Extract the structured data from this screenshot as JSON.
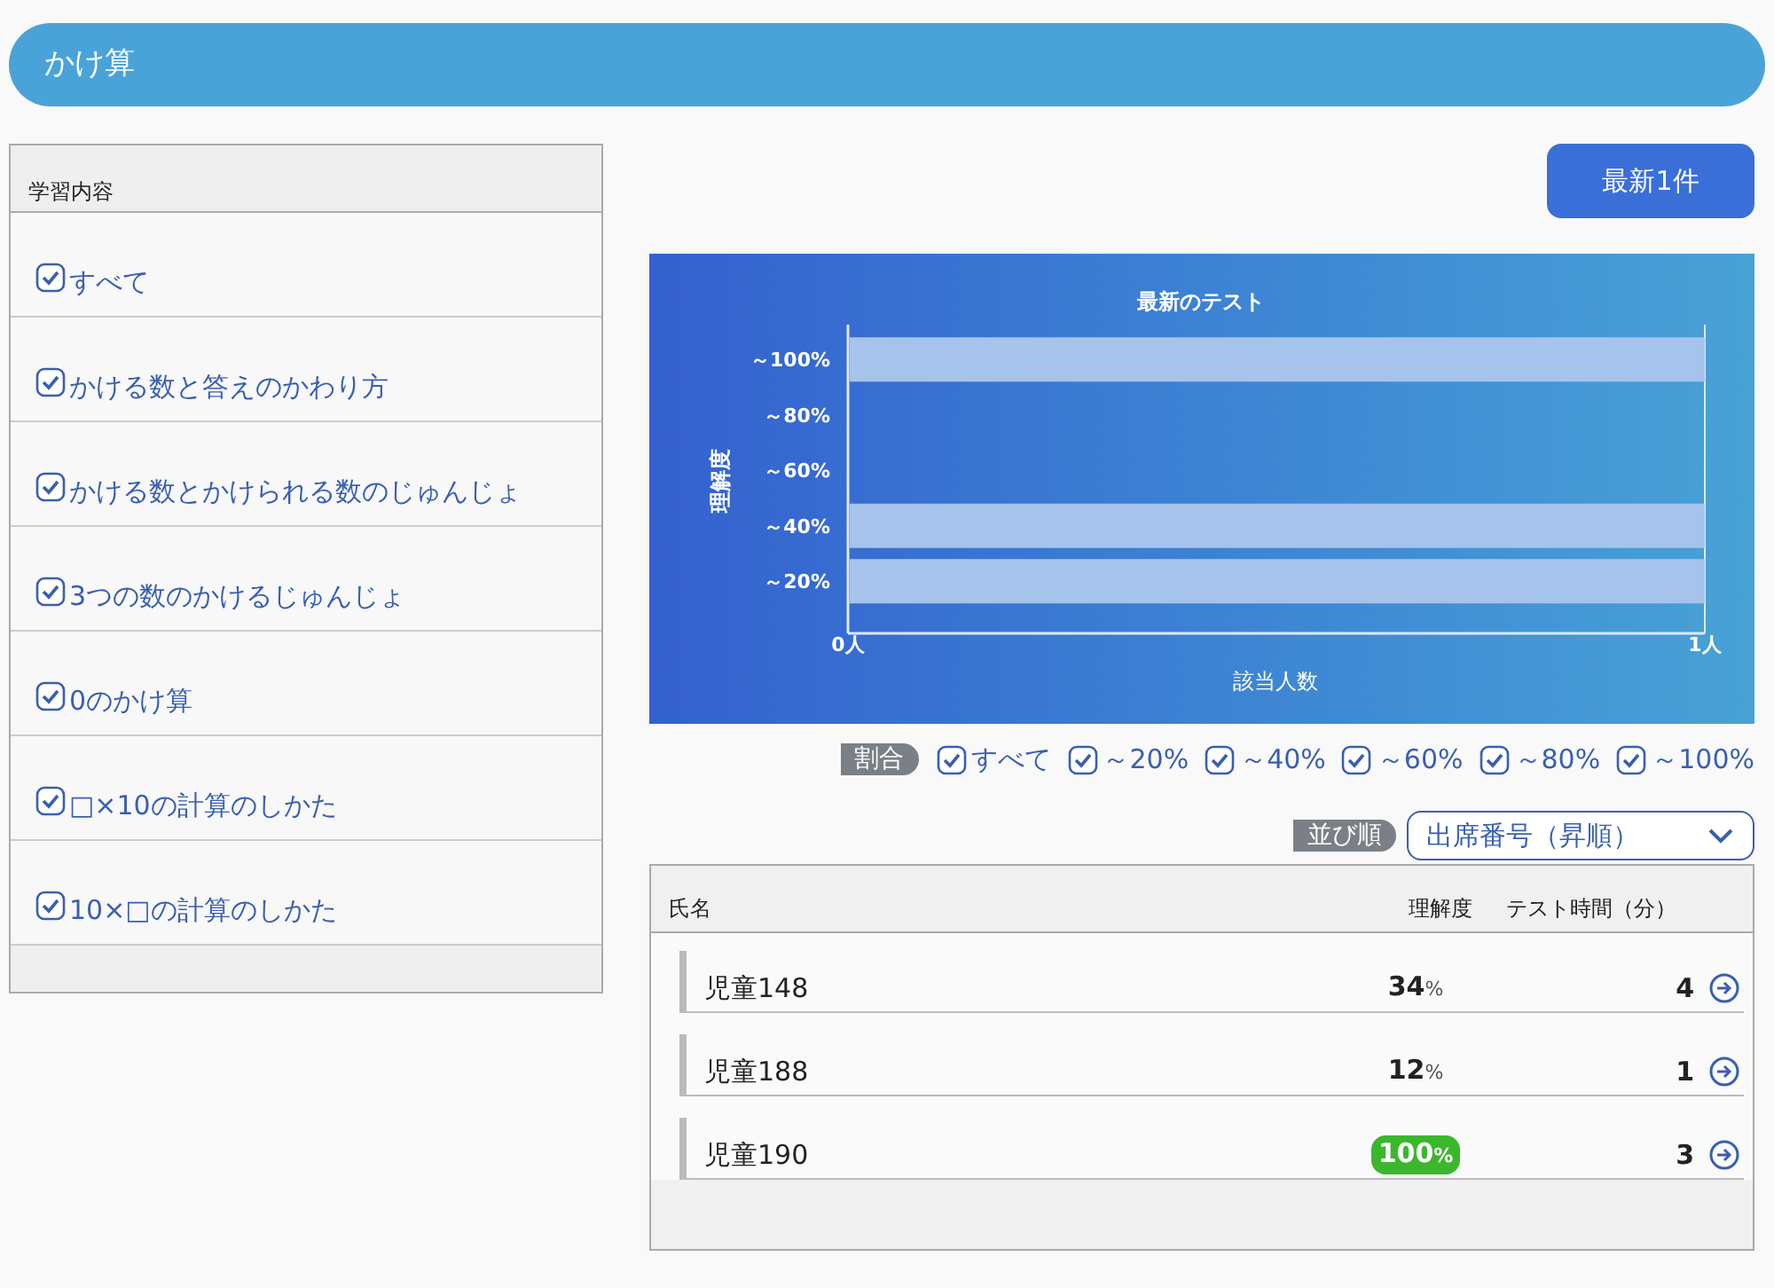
{
  "header": {
    "title": "かけ算"
  },
  "content_list": {
    "heading": "学習内容",
    "items": [
      {
        "label": "すべて",
        "checked": true
      },
      {
        "label": "かける数と答えのかわり方",
        "checked": true
      },
      {
        "label": "かける数とかけられる数のじゅんじょ",
        "checked": true
      },
      {
        "label": "3つの数のかけるじゅんじょ",
        "checked": true
      },
      {
        "label": "0のかけ算",
        "checked": true
      },
      {
        "label": "□×10の計算のしかた",
        "checked": true
      },
      {
        "label": "10×□の計算のしかた",
        "checked": true
      }
    ]
  },
  "latest_button": "最新1件",
  "chart_data": {
    "type": "bar",
    "orientation": "horizontal",
    "title": "最新のテスト",
    "xlabel": "該当人数",
    "ylabel": "理解度",
    "categories": [
      "～100%",
      "～80%",
      "～60%",
      "～40%",
      "～20%"
    ],
    "series": [
      {
        "color": "#a6c3ec",
        "values": [
          1,
          0,
          0,
          1,
          1
        ]
      }
    ],
    "xlim": [
      0,
      1
    ],
    "xticks": [
      {
        "value": 0,
        "label": "0人"
      },
      {
        "value": 1,
        "label": "1人"
      }
    ]
  },
  "ratio_filter": {
    "label": "割合",
    "options": [
      {
        "label": "すべて",
        "checked": true
      },
      {
        "label": "～20%",
        "checked": true
      },
      {
        "label": "～40%",
        "checked": true
      },
      {
        "label": "～60%",
        "checked": true
      },
      {
        "label": "～80%",
        "checked": true
      },
      {
        "label": "～100%",
        "checked": true
      }
    ]
  },
  "sort": {
    "label": "並び順",
    "value": "出席番号（昇順）"
  },
  "table": {
    "columns": [
      "氏名",
      "理解度",
      "テスト時間（分）"
    ],
    "rows": [
      {
        "name": "児童148",
        "score": "34",
        "unit": "%",
        "time": "4",
        "highlight": false
      },
      {
        "name": "児童188",
        "score": "12",
        "unit": "%",
        "time": "1",
        "highlight": false
      },
      {
        "name": "児童190",
        "score": "100",
        "unit": "%",
        "time": "3",
        "highlight": true
      }
    ]
  }
}
